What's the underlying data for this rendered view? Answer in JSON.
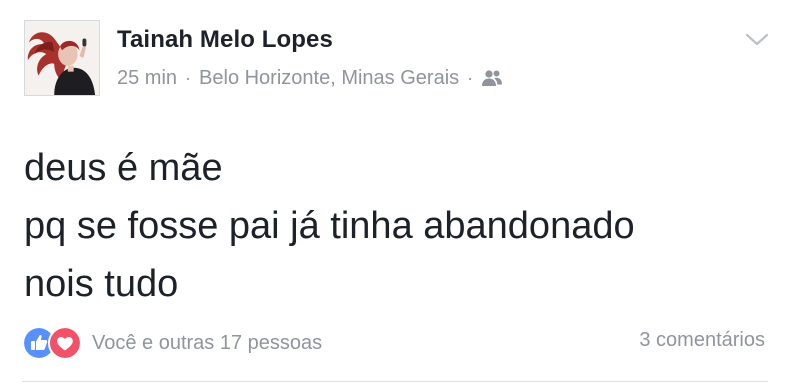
{
  "post": {
    "author": "Tainah Melo Lopes",
    "time": "25 min",
    "separator": "·",
    "location": "Belo Horizonte, Minas Gerais",
    "audience_icon": "friends-icon",
    "text_lines": [
      "deus é mãe",
      "pq se fosse pai já tinha abandonado",
      "nois tudo"
    ]
  },
  "reactions": {
    "icons": [
      "like-icon",
      "love-icon"
    ],
    "summary": "Você e outras 17 pessoas",
    "like_color": "#5890ff",
    "love_color": "#f25268"
  },
  "comments": {
    "count_label": "3 comentários"
  },
  "colors": {
    "text_primary": "#1d2129",
    "text_secondary": "#90949c",
    "divider": "#dddfe2"
  }
}
